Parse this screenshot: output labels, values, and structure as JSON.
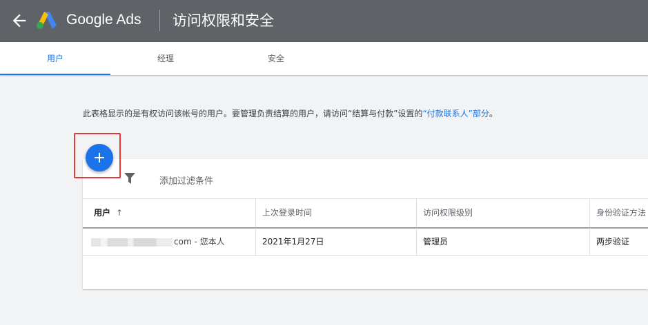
{
  "app": {
    "brand": "Google Ads",
    "page_title": "访问权限和安全"
  },
  "tabs": [
    {
      "label": "用户",
      "active": true
    },
    {
      "label": "经理",
      "active": false
    },
    {
      "label": "安全",
      "active": false
    }
  ],
  "description": {
    "text": "此表格显示的是有权访问该帐号的用户。要管理负责结算的用户，请访问“结算与付款”设置的",
    "link": "“付款联系人”部分",
    "suffix": "。"
  },
  "filter": {
    "label": "添加过滤条件",
    "icon": "filter-icon"
  },
  "table": {
    "columns": [
      "用户",
      "上次登录时间",
      "访问权限级别",
      "身份验证方法"
    ],
    "sort_indicator": "↑",
    "rows": [
      {
        "user": "com - 您本人",
        "last_login": "2021年1月27日",
        "access_level": "管理员",
        "auth_method": "两步验证"
      }
    ]
  },
  "colors": {
    "app_bar": "#5f6368",
    "accent": "#1a73e8",
    "highlight": "#e53935"
  }
}
